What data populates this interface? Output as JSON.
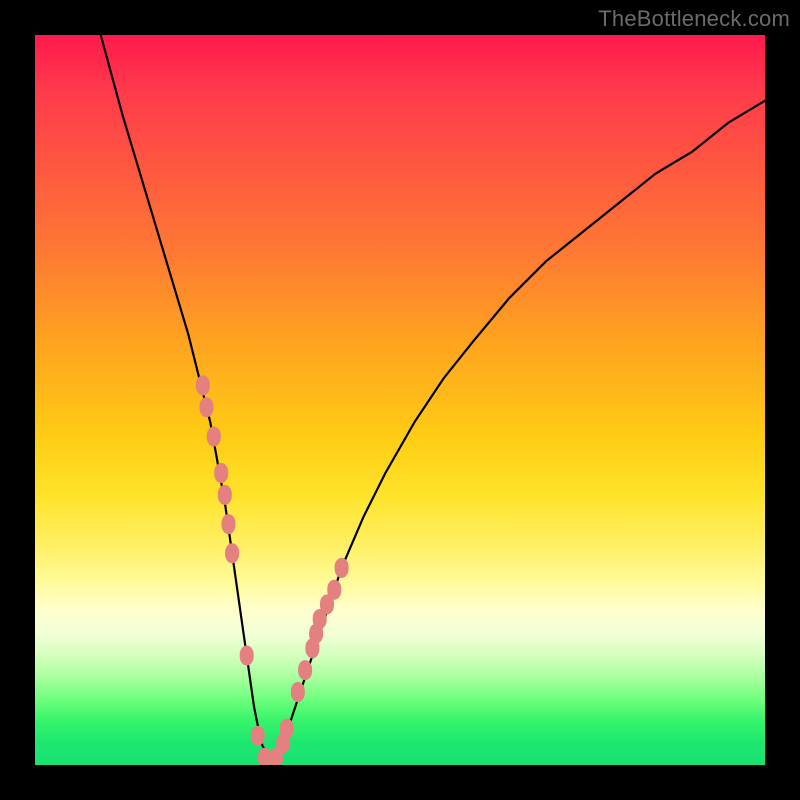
{
  "watermark": "TheBottleneck.com",
  "chart_data": {
    "type": "line",
    "title": "",
    "xlabel": "",
    "ylabel": "",
    "xlim": [
      0,
      100
    ],
    "ylim": [
      0,
      100
    ],
    "grid": false,
    "legend": false,
    "series": [
      {
        "name": "curve",
        "x": [
          9,
          12,
          15,
          18,
          21,
          24,
          26,
          27,
          28,
          29,
          30,
          31,
          32,
          33,
          34,
          36,
          38,
          40,
          42,
          45,
          48,
          52,
          56,
          60,
          65,
          70,
          75,
          80,
          85,
          90,
          95,
          100
        ],
        "y": [
          100,
          89,
          79,
          69,
          59,
          47,
          36,
          29,
          22,
          15,
          8,
          3,
          1,
          1,
          3,
          9,
          15,
          21,
          27,
          34,
          40,
          47,
          53,
          58,
          64,
          69,
          73,
          77,
          81,
          84,
          88,
          91
        ]
      }
    ],
    "markers": {
      "name": "scatter-points",
      "color": "#e48080",
      "x": [
        23.0,
        23.5,
        24.5,
        25.5,
        26.0,
        26.5,
        27.0,
        29.0,
        30.5,
        31.5,
        33.0,
        34.0,
        34.5,
        36.0,
        37.0,
        38.0,
        38.5,
        39.0,
        40.0,
        41.0,
        42.0
      ],
      "y": [
        52,
        49,
        45,
        40,
        37,
        33,
        29,
        15,
        4,
        1,
        1,
        3,
        5,
        10,
        13,
        16,
        18,
        20,
        22,
        24,
        27
      ]
    },
    "background_gradient": {
      "direction": "vertical",
      "stops": [
        {
          "pos": 0.0,
          "color": "#ff1a4d"
        },
        {
          "pos": 0.55,
          "color": "#ffcc14"
        },
        {
          "pos": 0.8,
          "color": "#ffffd0"
        },
        {
          "pos": 1.0,
          "color": "#19e270"
        }
      ]
    }
  }
}
